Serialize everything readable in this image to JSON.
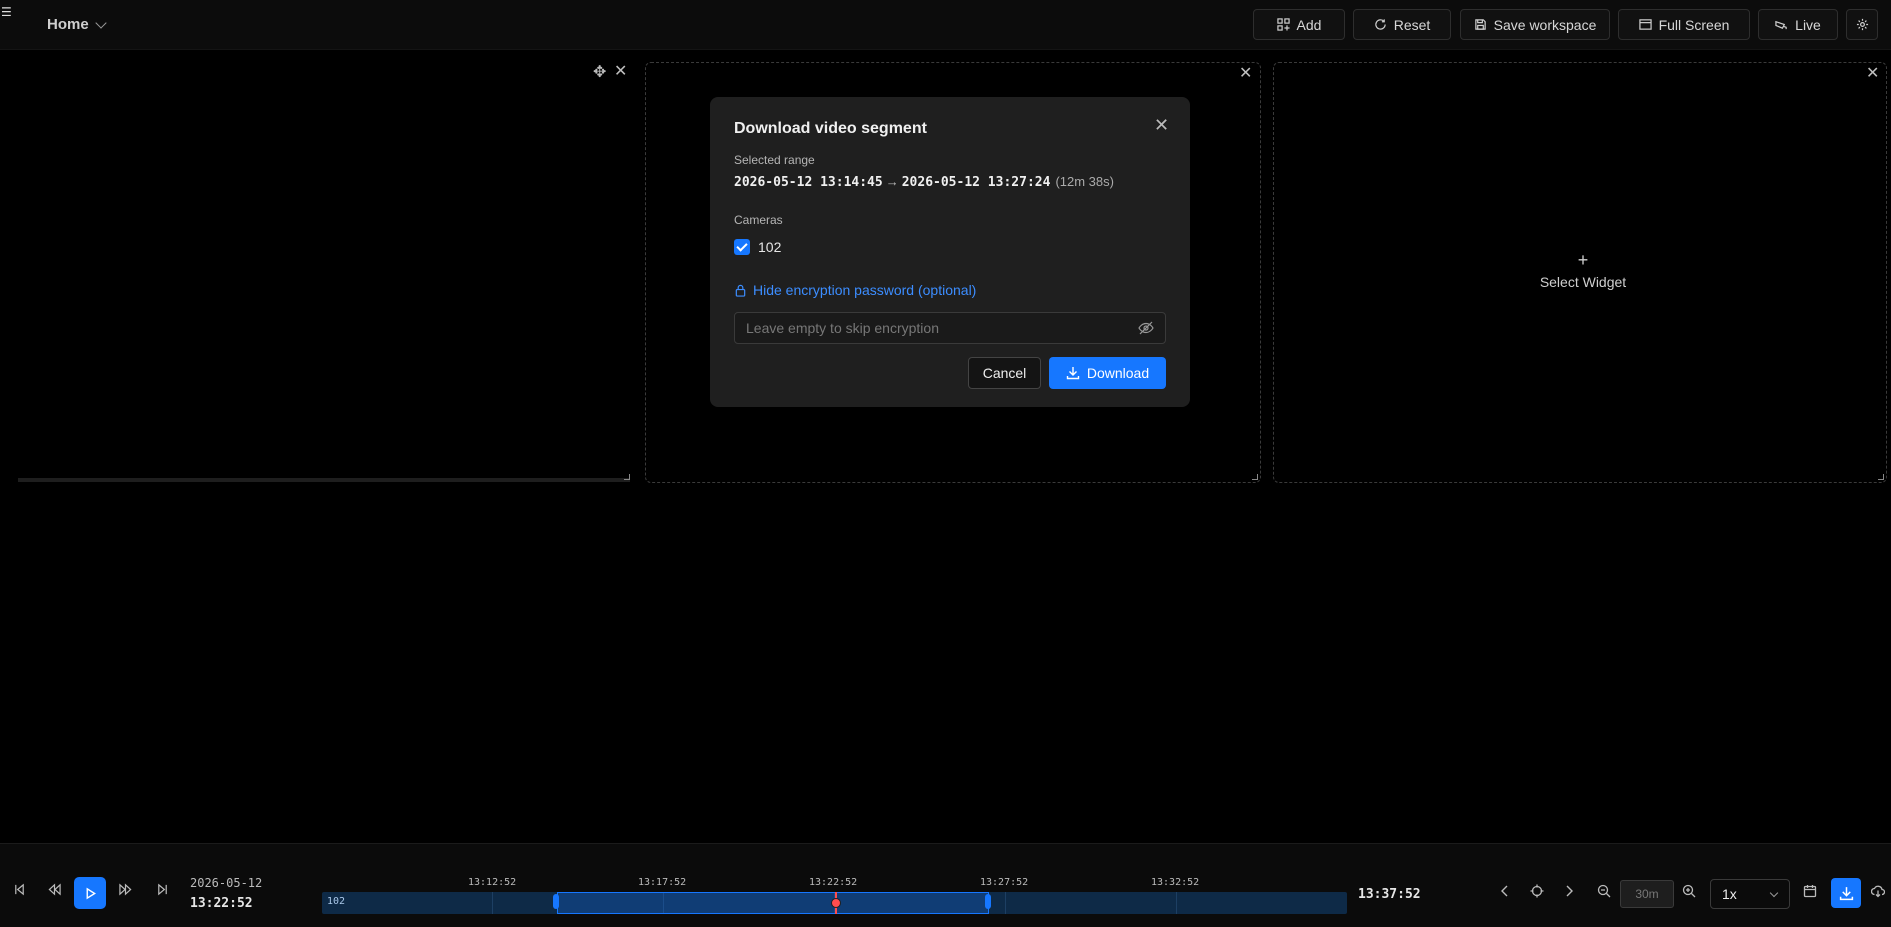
{
  "header": {
    "menu_icon": "hamburger-icon",
    "home_label": "Home",
    "buttons": {
      "add": "Add",
      "reset": "Reset",
      "save_workspace": "Save workspace",
      "full_screen": "Full Screen",
      "live": "Live"
    }
  },
  "widgets": {
    "select_widget_plus": "+",
    "select_widget_label": "Select Widget"
  },
  "modal": {
    "title": "Download video segment",
    "selected_range_label": "Selected range",
    "range_start": "2026-05-12 13:14:45",
    "range_arrow": "→",
    "range_end": "2026-05-12 13:27:24",
    "range_duration": "(12m 38s)",
    "cameras_label": "Cameras",
    "cameras": [
      {
        "label": "102",
        "checked": true
      }
    ],
    "encryption_toggle": "Hide encryption password (optional)",
    "password_placeholder": "Leave empty to skip encryption",
    "cancel": "Cancel",
    "download": "Download"
  },
  "timeline": {
    "current_date": "2026-05-12",
    "current_time": "13:22:52",
    "ticks": [
      "13:12:52",
      "13:17:52",
      "13:22:52",
      "13:27:52",
      "13:32:52"
    ],
    "track_label": "102",
    "end_time": "13:37:52",
    "zoom": "30m",
    "speed": "1x"
  },
  "colors": {
    "accent": "#1677ff",
    "cursor": "#ff4d4f",
    "link": "#3c8dff"
  }
}
